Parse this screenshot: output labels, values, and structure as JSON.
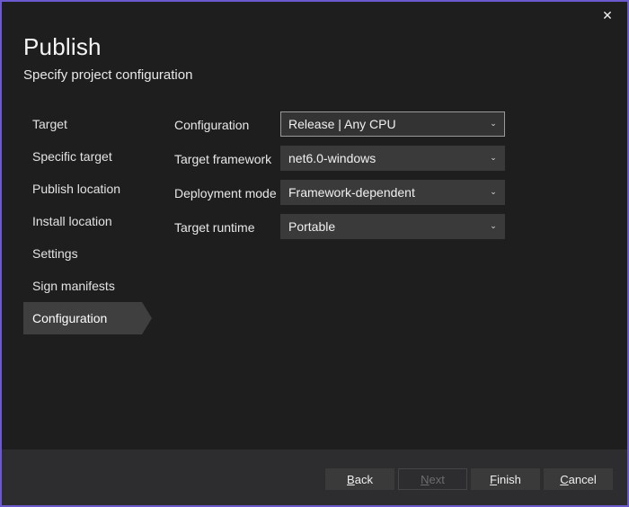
{
  "window": {
    "close_icon": "close-icon",
    "close_glyph": "✕",
    "accent_color": "#6a5acd",
    "background": "#1e1e1e",
    "footer_background": "#2d2d30"
  },
  "header": {
    "title": "Publish",
    "subtitle": "Specify project configuration"
  },
  "sidebar": {
    "items": [
      {
        "label": "Target",
        "selected": false
      },
      {
        "label": "Specific target",
        "selected": false
      },
      {
        "label": "Publish location",
        "selected": false
      },
      {
        "label": "Install location",
        "selected": false
      },
      {
        "label": "Settings",
        "selected": false
      },
      {
        "label": "Sign manifests",
        "selected": false
      },
      {
        "label": "Configuration",
        "selected": true
      }
    ]
  },
  "form": {
    "chevron_glyph": "⌄",
    "rows": [
      {
        "label": "Configuration",
        "value": "Release | Any CPU",
        "focused": true,
        "name": "configuration"
      },
      {
        "label": "Target framework",
        "value": "net6.0-windows",
        "focused": false,
        "name": "target-framework"
      },
      {
        "label": "Deployment mode",
        "value": "Framework-dependent",
        "focused": false,
        "name": "deployment-mode"
      },
      {
        "label": "Target runtime",
        "value": "Portable",
        "focused": false,
        "name": "target-runtime"
      }
    ]
  },
  "footer": {
    "buttons": [
      {
        "accel": "B",
        "rest": "ack",
        "name": "back",
        "disabled": false
      },
      {
        "accel": "N",
        "rest": "ext",
        "name": "next",
        "disabled": true
      },
      {
        "accel": "F",
        "rest": "inish",
        "name": "finish",
        "disabled": false
      },
      {
        "accel": "C",
        "rest": "ancel",
        "name": "cancel",
        "disabled": false
      }
    ]
  }
}
